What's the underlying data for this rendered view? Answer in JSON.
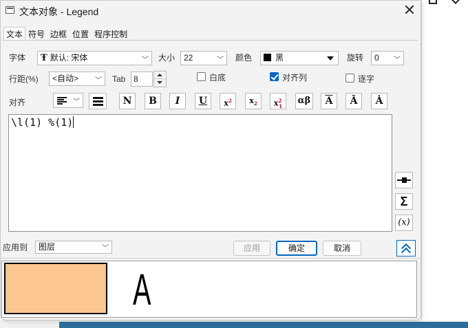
{
  "window": {
    "title": "文本对象 - Legend",
    "close_glyph": "✕"
  },
  "tabs": [
    {
      "label": "文本",
      "active": true
    },
    {
      "label": "符号",
      "active": false
    },
    {
      "label": "边框",
      "active": false
    },
    {
      "label": "位置",
      "active": false
    },
    {
      "label": "程序控制",
      "active": false
    }
  ],
  "font": {
    "label": "字体",
    "value": "默认: 宋体",
    "icon": "truetype-icon",
    "glyph": "Ŧ"
  },
  "size": {
    "label": "大小",
    "value": "22"
  },
  "color": {
    "label": "颜色",
    "value": "黑",
    "swatch": "#000000"
  },
  "rotate": {
    "label": "旋转",
    "value": "0"
  },
  "line_spacing": {
    "label": "行距(%)",
    "value": "<自动>"
  },
  "tab_width": {
    "label": "Tab",
    "value": "8"
  },
  "checkboxes": {
    "white_bg": {
      "label": "白底",
      "checked": false
    },
    "align_columns": {
      "label": "对齐列",
      "checked": true
    },
    "char_by_char": {
      "label": "逐字",
      "checked": false
    }
  },
  "align": {
    "label": "对齐"
  },
  "format_buttons": [
    {
      "name": "normal-button",
      "label": "N"
    },
    {
      "name": "bold-button",
      "label": "B"
    },
    {
      "name": "italic-button",
      "label": "I"
    },
    {
      "name": "underline-button",
      "label": "U"
    },
    {
      "name": "superscript-button",
      "label": "x"
    },
    {
      "name": "subscript-button",
      "label": "x"
    },
    {
      "name": "supsub-button",
      "label": "x"
    },
    {
      "name": "greek-button",
      "label": "αβ"
    },
    {
      "name": "overbar-button",
      "label": "A"
    },
    {
      "name": "tilde-button",
      "label": "Ã"
    },
    {
      "name": "dot-button",
      "label": "Ȧ"
    }
  ],
  "format_marks": {
    "sup": "2",
    "sub": "2",
    "supsub_sup": "2",
    "supsub_sub": "1"
  },
  "editor": {
    "text": "\\l(1) %(1)"
  },
  "side_buttons": {
    "legend_symbol": "legend-symbol-icon",
    "sigma": "Σ",
    "variable": "(x)"
  },
  "apply_to": {
    "label": "应用到",
    "value": "图层"
  },
  "buttons": {
    "apply": "应用",
    "ok": "确定",
    "cancel": "取消"
  },
  "preview": {
    "swatch_color": "#fcc690",
    "letter": "A"
  }
}
